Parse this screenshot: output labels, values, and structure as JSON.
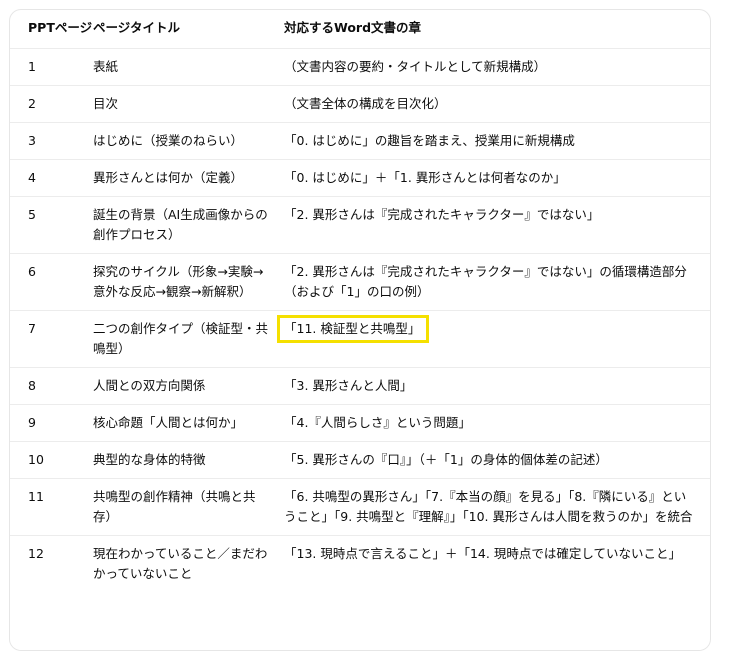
{
  "table": {
    "headers": [
      "PPTページ",
      "ページタイトル",
      "対応するWord文書の章"
    ],
    "rows": [
      {
        "page": "1",
        "title": "表紙",
        "chapter": "（文書内容の要約・タイトルとして新規構成）"
      },
      {
        "page": "2",
        "title": "目次",
        "chapter": "（文書全体の構成を目次化）"
      },
      {
        "page": "3",
        "title": "はじめに（授業のねらい）",
        "chapter": "「0. はじめに」の趣旨を踏まえ、授業用に新規構成"
      },
      {
        "page": "4",
        "title": "異形さんとは何か（定義）",
        "chapter": "「0. はじめに」＋「1. 異形さんとは何者なのか」"
      },
      {
        "page": "5",
        "title": "誕生の背景（AI生成画像からの創作プロセス）",
        "chapter": "「2. 異形さんは『完成されたキャラクター』ではない」"
      },
      {
        "page": "6",
        "title": "探究のサイクル（形象→実験→意外な反応→観察→新解釈）",
        "chapter": "「2. 異形さんは『完成されたキャラクター』ではない」の循環構造部分（および「1」の口の例）"
      },
      {
        "page": "7",
        "title": "二つの創作タイプ（検証型・共鳴型）",
        "chapter": "「11. 検証型と共鳴型」"
      },
      {
        "page": "8",
        "title": "人間との双方向関係",
        "chapter": "「3. 異形さんと人間」"
      },
      {
        "page": "9",
        "title": "核心命題「人間とは何か」",
        "chapter": "「4.『人間らしさ』という問題」"
      },
      {
        "page": "10",
        "title": "典型的な身体的特徴",
        "chapter": "「5. 異形さんの『口』」（＋「1」の身体的個体差の記述）"
      },
      {
        "page": "11",
        "title": "共鳴型の創作精神（共鳴と共存）",
        "chapter": "「6. 共鳴型の異形さん」「7.『本当の顔』を見る」「8.『隣にいる』ということ」「9. 共鳴型と『理解』」「10. 異形さんは人間を救うのか」を統合"
      },
      {
        "page": "12",
        "title": "現在わかっていること／まだわかっていないこと",
        "chapter": "「13. 現時点で言えること」＋「14. 現時点では確定していないこと」"
      }
    ],
    "highlighted_row": 7,
    "highlight_color": "#f5e000"
  }
}
